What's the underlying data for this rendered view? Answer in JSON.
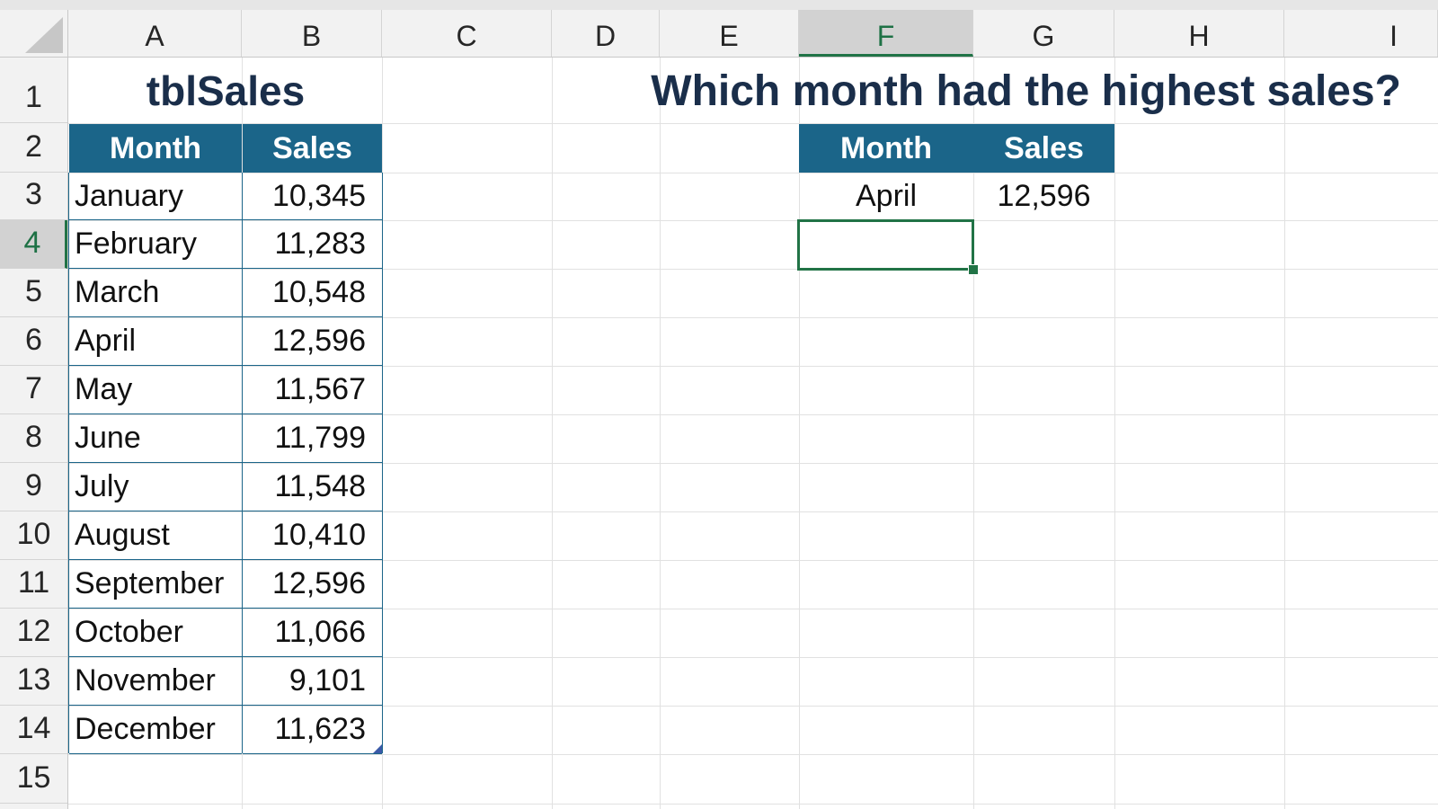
{
  "columns": [
    "A",
    "B",
    "C",
    "D",
    "E",
    "F",
    "G",
    "H",
    "I"
  ],
  "rows": [
    "1",
    "2",
    "3",
    "4",
    "5",
    "6",
    "7",
    "8",
    "9",
    "10",
    "11",
    "12",
    "13",
    "14",
    "15"
  ],
  "selected_column": "F",
  "selected_row": "4",
  "table": {
    "name": "tblSales",
    "header_month": "Month",
    "header_sales": "Sales",
    "data": [
      {
        "month": "January",
        "sales": "10,345"
      },
      {
        "month": "February",
        "sales": "11,283"
      },
      {
        "month": "March",
        "sales": "10,548"
      },
      {
        "month": "April",
        "sales": "12,596"
      },
      {
        "month": "May",
        "sales": "11,567"
      },
      {
        "month": "June",
        "sales": "11,799"
      },
      {
        "month": "July",
        "sales": "11,548"
      },
      {
        "month": "August",
        "sales": "10,410"
      },
      {
        "month": "September",
        "sales": "12,596"
      },
      {
        "month": "October",
        "sales": "11,066"
      },
      {
        "month": "November",
        "sales": "9,101"
      },
      {
        "month": "December",
        "sales": "11,623"
      }
    ]
  },
  "question": {
    "title": "Which month had the highest sales?",
    "header_month": "Month",
    "header_sales": "Sales",
    "result_month": "April",
    "result_sales": "12,596"
  },
  "colors": {
    "table_header": "#1b6589",
    "selection": "#217346",
    "title_text": "#1a2e4a"
  }
}
